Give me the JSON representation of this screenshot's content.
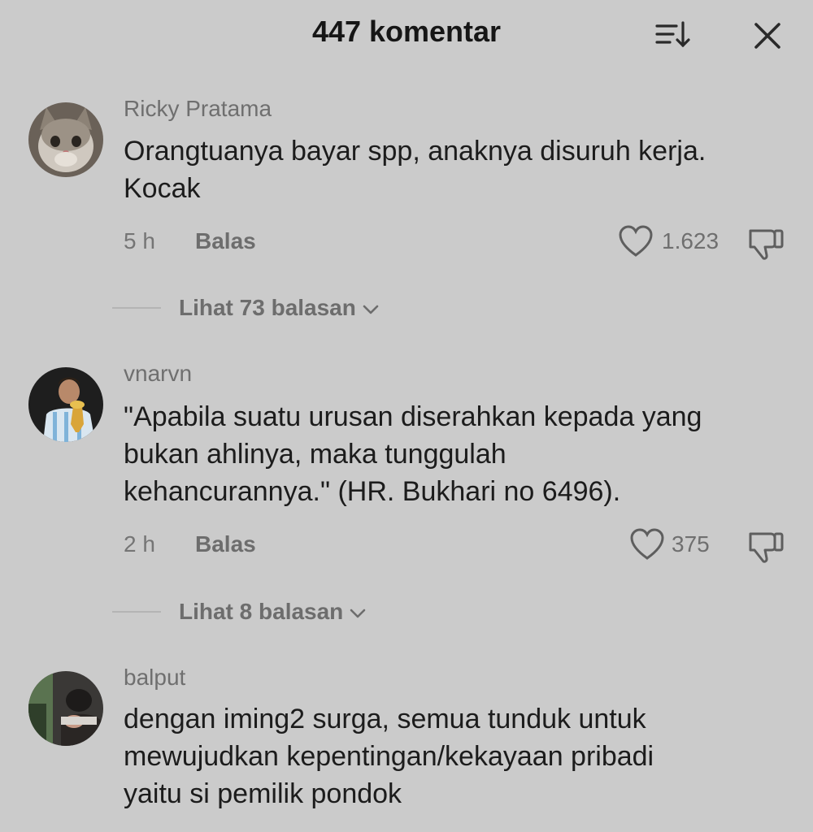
{
  "header": {
    "title": "447 komentar",
    "sort_icon": "sort-icon",
    "close_icon": "close-icon"
  },
  "comments": [
    {
      "username": "Ricky Pratama",
      "avatar": "cat-avatar",
      "text_lines": [
        "Orangtuanya bayar spp, anaknya disuruh kerja.",
        "Kocak"
      ],
      "time": "5 h",
      "reply_label": "Balas",
      "likes": "1.623",
      "view_replies": "Lihat 73 balasan"
    },
    {
      "username": "vnarvn",
      "avatar": "football-player-avatar",
      "text_lines": [
        "\"Apabila suatu urusan diserahkan kepada yang",
        "bukan ahlinya, maka tunggulah",
        "kehancurannya.\" (HR. Bukhari no 6496)."
      ],
      "time": "2 h",
      "reply_label": "Balas",
      "likes": "375",
      "view_replies": "Lihat 8 balasan"
    },
    {
      "username": "balput",
      "avatar": "person-avatar",
      "text_lines": [
        "dengan iming2 surga, semua tunduk untuk",
        "mewujudkan kepentingan/kekayaan pribadi",
        "yaitu si pemilik pondok"
      ]
    }
  ]
}
